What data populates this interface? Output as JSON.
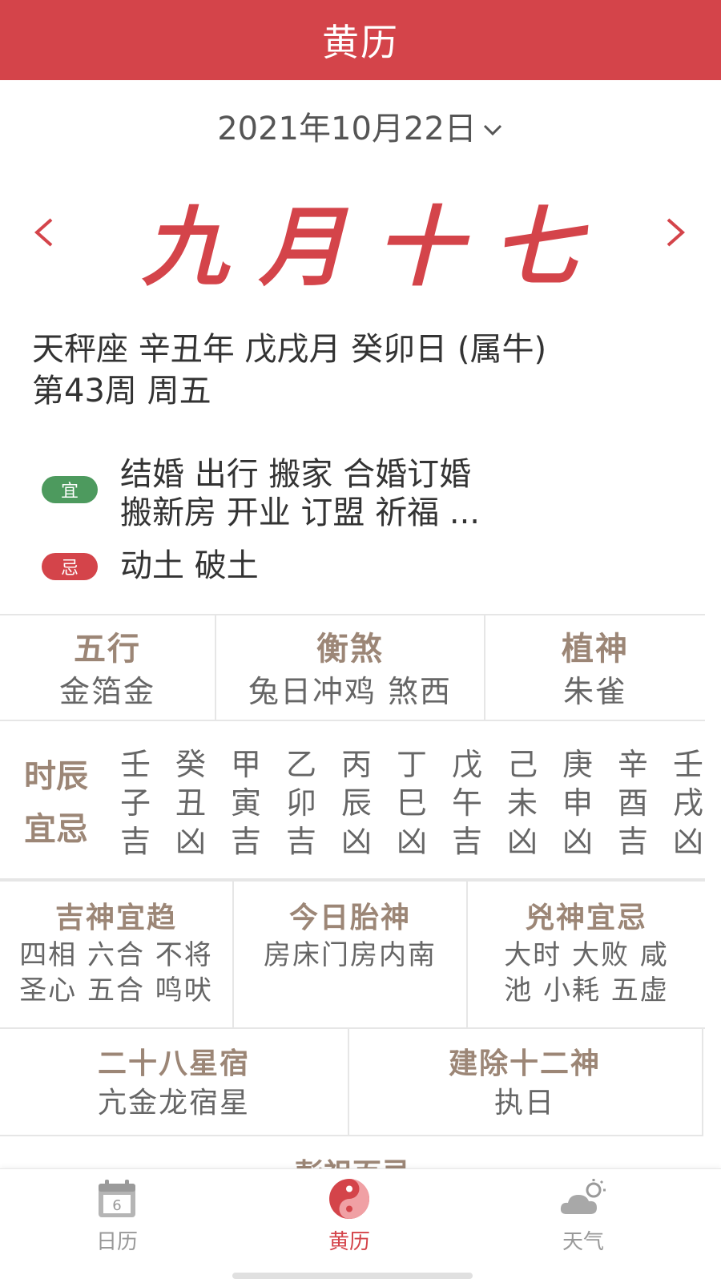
{
  "header": {
    "title": "黄历"
  },
  "date_selector": {
    "text": "2021年10月22日"
  },
  "lunar": {
    "text": "九月十七"
  },
  "info": {
    "line1": "天秤座 辛丑年 戊戌月 癸卯日 (属牛)",
    "line2": "第43周 周五"
  },
  "yi": {
    "badge": "宜",
    "line1": "结婚 出行 搬家 合婚订婚",
    "line2": "搬新房 开业 订盟 祈福 ..."
  },
  "ji": {
    "badge": "忌",
    "text": "动土 破土"
  },
  "row1": [
    {
      "title": "五行",
      "value": "金箔金"
    },
    {
      "title": "衡煞",
      "value": "兔日冲鸡 煞西"
    },
    {
      "title": "植神",
      "value": "朱雀"
    }
  ],
  "hours": {
    "label_line1": "时辰",
    "label_line2": "宜忌",
    "columns": [
      {
        "stem": "壬",
        "branch": "子",
        "luck": "吉"
      },
      {
        "stem": "癸",
        "branch": "丑",
        "luck": "凶"
      },
      {
        "stem": "甲",
        "branch": "寅",
        "luck": "吉"
      },
      {
        "stem": "乙",
        "branch": "卯",
        "luck": "吉"
      },
      {
        "stem": "丙",
        "branch": "辰",
        "luck": "凶"
      },
      {
        "stem": "丁",
        "branch": "巳",
        "luck": "凶"
      },
      {
        "stem": "戊",
        "branch": "午",
        "luck": "吉"
      },
      {
        "stem": "己",
        "branch": "未",
        "luck": "凶"
      },
      {
        "stem": "庚",
        "branch": "申",
        "luck": "凶"
      },
      {
        "stem": "辛",
        "branch": "酉",
        "luck": "吉"
      },
      {
        "stem": "壬",
        "branch": "戌",
        "luck": "凶"
      }
    ]
  },
  "row3": [
    {
      "title": "吉神宜趋",
      "value_line1": "四相 六合 不将",
      "value_line2": "圣心 五合 鸣吠"
    },
    {
      "title": "今日胎神",
      "value_line1": "房床门房内南",
      "value_line2": ""
    },
    {
      "title": "兇神宜忌",
      "value_line1": "大时 大败 咸",
      "value_line2": "池 小耗 五虚"
    }
  ],
  "row4": [
    {
      "title": "二十八星宿",
      "value": "亢金龙宿星"
    },
    {
      "title": "建除十二神",
      "value": "执日"
    }
  ],
  "peek": {
    "title": "彭祖百忌"
  },
  "tabbar": {
    "calendar": {
      "label": "日历",
      "icon_number": "6"
    },
    "huangli": {
      "label": "黄历"
    },
    "weather": {
      "label": "天气"
    }
  },
  "colors": {
    "primary": "#d4444a",
    "good": "#4d9a5e",
    "title": "#9c8676"
  }
}
